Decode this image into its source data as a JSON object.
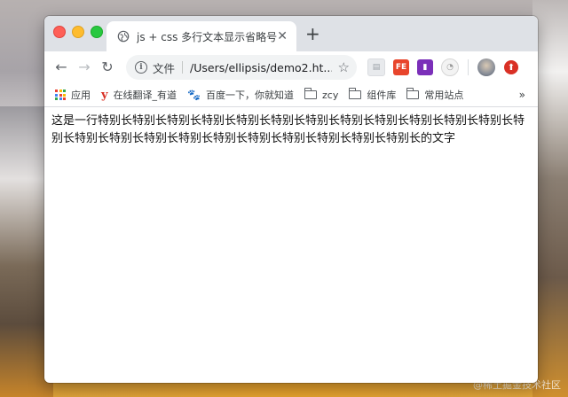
{
  "tab": {
    "title": "js + css 多行文本显示省略号"
  },
  "toolbar": {
    "scheme_label": "文件",
    "url": "/Users/ellipsis/demo2.ht..."
  },
  "extensions": {
    "fe_label": "FE"
  },
  "bookmarks": [
    {
      "icon": "apps-grid-icon",
      "label": "应用"
    },
    {
      "icon": "youdao-icon",
      "label": "在线翻译_有道"
    },
    {
      "icon": "baidu-paw-icon",
      "label": "百度一下，你就知道"
    },
    {
      "icon": "folder-icon",
      "label": "zcy"
    },
    {
      "icon": "folder-icon",
      "label": "组件库"
    },
    {
      "icon": "folder-icon",
      "label": "常用站点"
    }
  ],
  "content": {
    "text": "这是一行特别长特别长特别长特别长特别长特别长特别长特别长特别长特别长特别长特别长特别长特别长特别长特别长特别长特别长特别长特别长特别长特别长特别长的文字"
  },
  "watermark": "@稀土掘金技术社区",
  "colors": {
    "close": "#fe5f57",
    "minimize": "#febc2e",
    "maximize": "#28c840"
  }
}
